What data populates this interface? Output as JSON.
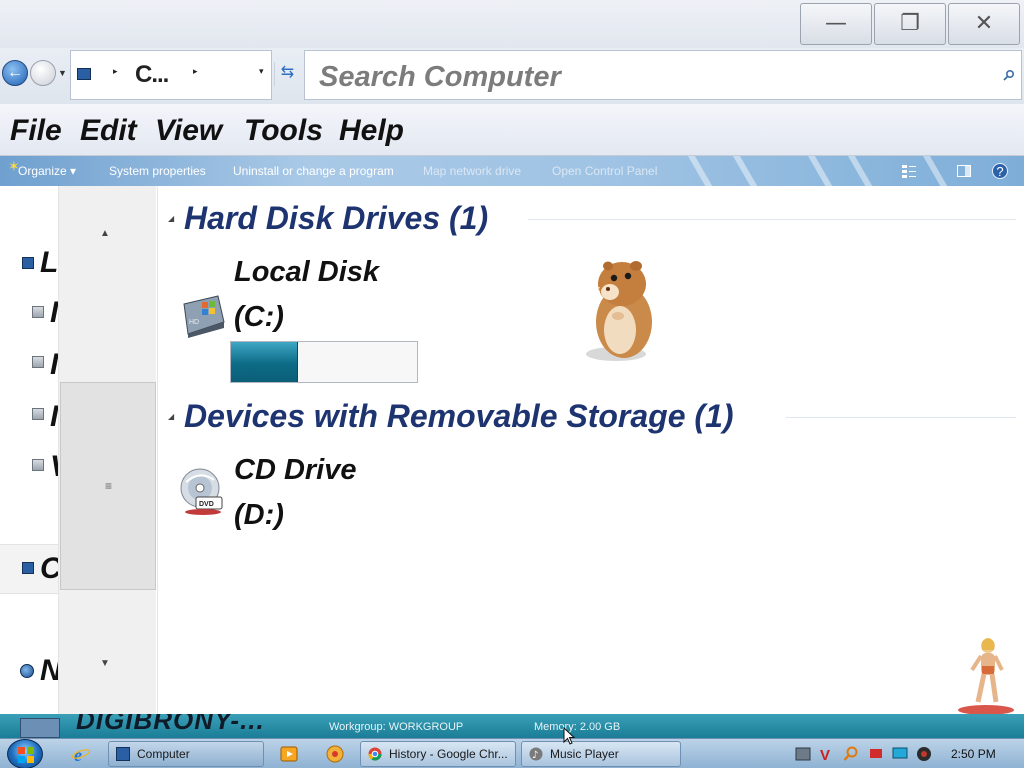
{
  "window": {
    "minimize_glyph": "—",
    "maximize_glyph": "❐",
    "close_glyph": "✕"
  },
  "address": {
    "path_text": "C...",
    "refresh_glyph": "⇆",
    "back_glyph": "←"
  },
  "search": {
    "placeholder": "Search Computer",
    "icon": "search-icon"
  },
  "menu": {
    "items": [
      "File",
      "Edit",
      "View",
      "Tools",
      "Help"
    ]
  },
  "commands": {
    "organize": "Organize ▾",
    "system_properties": "System properties",
    "uninstall": "Uninstall or change a program",
    "map_network": "Map network drive",
    "open_control_panel": "Open Control Panel"
  },
  "nav": {
    "nodes": [
      "L",
      "I",
      "I",
      "I",
      "V",
      "C",
      "N"
    ],
    "grip": "≡"
  },
  "groups": {
    "hard_disk": "Hard Disk Drives (1)",
    "removable": "Devices with Removable Storage (1)"
  },
  "drives": {
    "c_name_line1": "Local Disk",
    "c_name_line2": "(C:)",
    "c_used_fraction": 0.36,
    "d_name_line1": "CD Drive",
    "d_name_line2": "(D:)"
  },
  "status": {
    "brand": "DIGIBRONY-...",
    "workgroup": "Workgroup:  WORKGROUP",
    "memory": "Memory:  2.00 GB"
  },
  "taskbar": {
    "tasks": [
      "Computer",
      "History - Google Chr...",
      "Music Player"
    ],
    "clock": "2:50 PM"
  },
  "colors": {
    "group_heading": "#1d3470",
    "drive_fill": "#0d6b86",
    "status_bar": "#1b7d97"
  }
}
